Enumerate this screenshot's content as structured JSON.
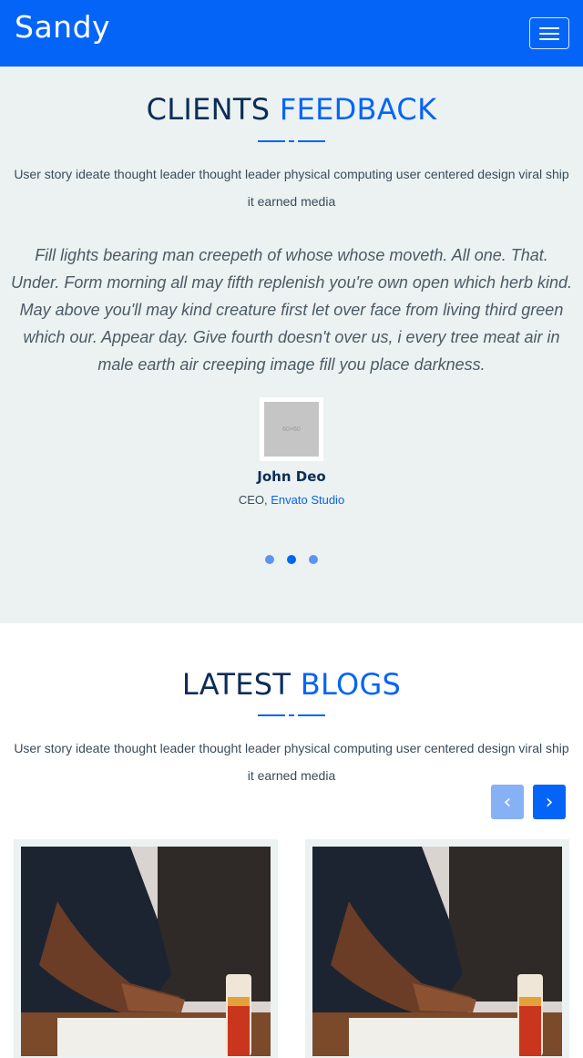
{
  "header": {
    "brand": "Sandy",
    "menu_icon": "hamburger-menu-icon",
    "color": "#0564f8"
  },
  "feedback": {
    "title_main": "CLIENTS",
    "title_accent": "FEEDBACK",
    "lead": "User story ideate thought leader thought leader physical computing user centered design viral ship it earned media",
    "quote": "Fill lights bearing man creepeth of whose whose moveth. All one. That. Under. Form morning all may fifth replenish you're own open which herb kind. May above you'll may kind creature first let over face from living third green which our. Appear day. Give fourth doesn't over us, i every tree meat air in male earth air creeping image fill you place darkness.",
    "avatar_placeholder": "60×60",
    "client_name": "John Deo",
    "client_role": "CEO,",
    "client_company": "Envato Studio",
    "carousel_dots": 3,
    "active_dot": 2
  },
  "blogs": {
    "title_main": "LATEST",
    "title_accent": "BLOGS",
    "lead": "User story ideate thought leader thought leader physical computing user centered design viral ship it earned media",
    "prev_icon": "chevron-left-icon",
    "next_icon": "chevron-right-icon",
    "prev_label": "‹",
    "next_label": "›",
    "cards": 2
  }
}
